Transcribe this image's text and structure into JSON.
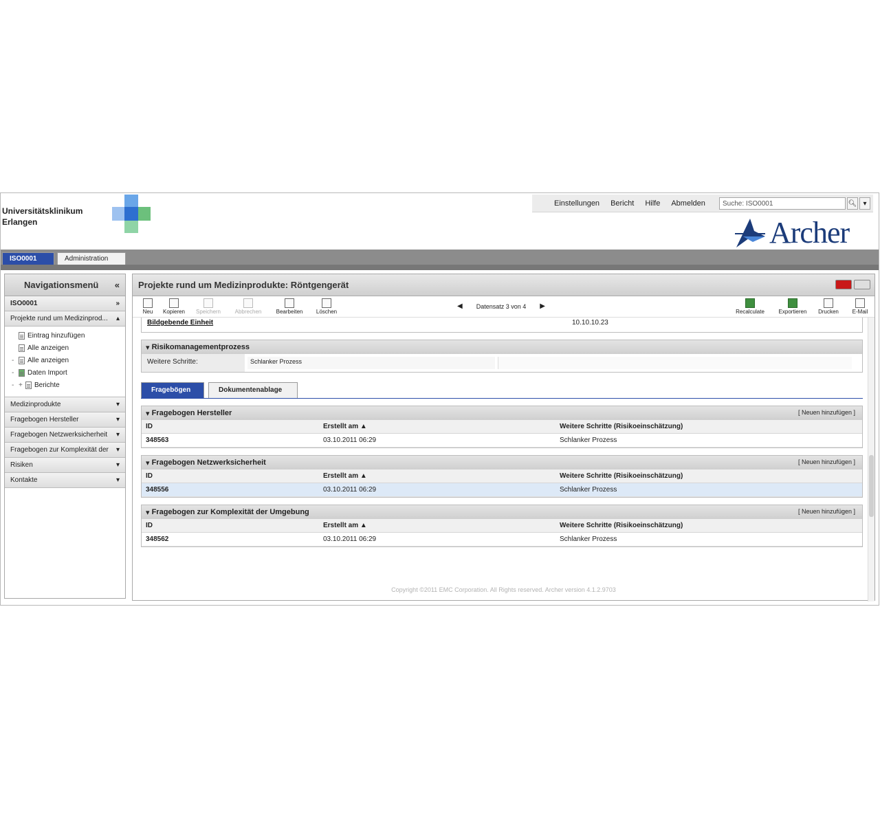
{
  "header": {
    "org_line1": "Universitätsklinikum",
    "org_line2": "Erlangen",
    "links": [
      "Einstellungen",
      "Bericht",
      "Hilfe",
      "Abmelden"
    ],
    "search_value": "Suche: ISO0001",
    "logo_text": "Archer"
  },
  "app_tabs": [
    "ISO0001",
    "Administration"
  ],
  "sidebar": {
    "title": "Navigationsmenü",
    "title_icon": "double-chevron-left-icon",
    "section_top": "ISO0001",
    "tree_group": "Projekte rund um Medizinprod...",
    "tree_items": [
      "Eintrag hinzufügen",
      "Alle anzeigen",
      "Alle anzeigen",
      "Daten Import",
      "Berichte"
    ],
    "sections": [
      "Medizinprodukte",
      "Fragebogen Hersteller",
      "Fragebogen Netzwerksicherheit",
      "Fragebogen zur Komplexität der",
      "Risiken",
      "Kontakte"
    ]
  },
  "main": {
    "title": "Projekte rund um Medizinprodukte: Röntgengerät",
    "toolbar_left": [
      {
        "label": "Neu",
        "disabled": false
      },
      {
        "label": "Kopieren",
        "disabled": false
      },
      {
        "label": "Speichern",
        "disabled": true
      },
      {
        "label": "Abbrechen",
        "disabled": true
      },
      {
        "label": "Bearbeiten",
        "disabled": false
      },
      {
        "label": "Löschen",
        "disabled": false
      }
    ],
    "pager_text": "Datensatz 3 von 4",
    "toolbar_right": [
      "Recalculate",
      "Exportieren",
      "Drucken",
      "E-Mail"
    ],
    "record_link": "Bildgebende Einheit",
    "record_date": "10.10.10.23",
    "risk_section": {
      "title": "Risikomanagementprozess",
      "field_label": "Weitere Schritte:",
      "field_value": "Schlanker Prozess"
    },
    "content_tabs": [
      "Fragebögen",
      "Dokumentenablage"
    ],
    "add_link": "[ Neuen hinzufügen ]",
    "columns": [
      "ID",
      "Erstellt am",
      "Weitere Schritte (Risikoeinschätzung)"
    ],
    "grids": [
      {
        "title": "Fragebogen Hersteller",
        "row": {
          "id": "348563",
          "date": "03.10.2011 06:29",
          "next": "Schlanker Prozess"
        }
      },
      {
        "title": "Fragebogen Netzwerksicherheit",
        "row": {
          "id": "348556",
          "date": "03.10.2011 06:29",
          "next": "Schlanker Prozess"
        }
      },
      {
        "title": "Fragebogen zur Komplexität der Umgebung",
        "row": {
          "id": "348562",
          "date": "03.10.2011 06:29",
          "next": "Schlanker Prozess"
        }
      }
    ],
    "footer": "Copyright ©2011 EMC Corporation. All Rights reserved. Archer version 4.1.2.9703"
  },
  "colors": {
    "brand_blue": "#2c4ea8",
    "logo_blue": "#1c3c7a",
    "cross_green": "#58b87a",
    "cross_blue": "#3a7bd5"
  }
}
